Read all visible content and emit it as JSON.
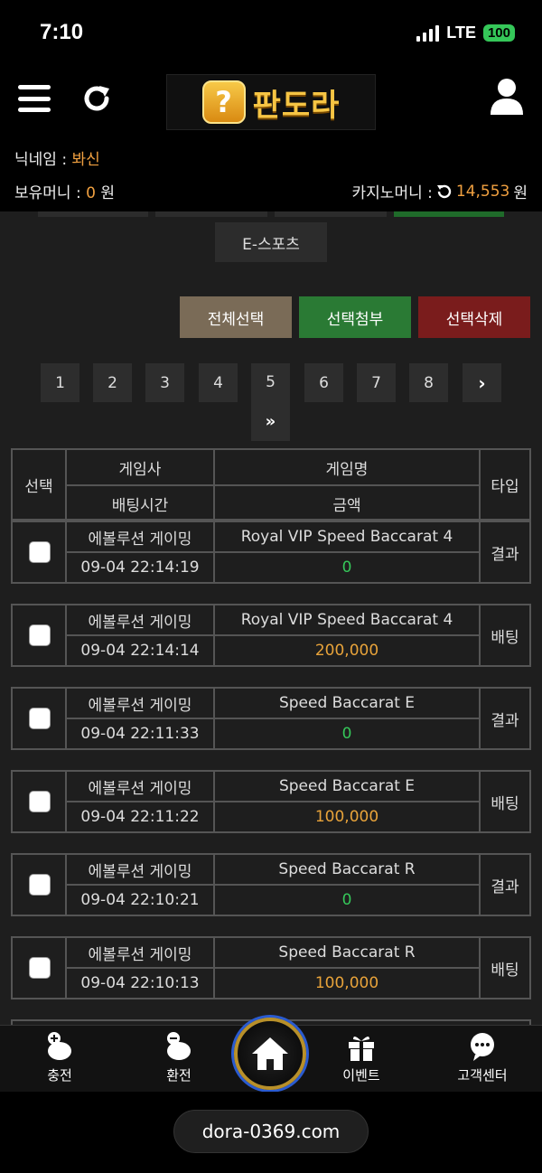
{
  "status_bar": {
    "time": "7:10",
    "network": "LTE",
    "battery": "100"
  },
  "header": {
    "logo_text": "판도라",
    "logo_symbol": "?"
  },
  "user_info": {
    "nickname_label": "닉네임 : ",
    "nickname_value": "봐신",
    "holding_label": "보유머니 : ",
    "holding_value": "0",
    "holding_unit": " 원",
    "casino_label": "카지노머니 : ",
    "casino_value": "14,553",
    "casino_unit": " 원"
  },
  "category_tab": "E-스포츠",
  "actions": {
    "select_all": "전체선택",
    "attach_selected": "선택첨부",
    "delete_selected": "선택삭제"
  },
  "pagination": {
    "pages": [
      "1",
      "2",
      "3",
      "4",
      "5",
      "6",
      "7",
      "8"
    ],
    "current": "5",
    "next": "›",
    "last": "»"
  },
  "table_headers": {
    "select": "선택",
    "provider": "게임사",
    "game": "게임명",
    "type": "타입",
    "bet_time": "배팅시간",
    "amount": "금액"
  },
  "rows": [
    {
      "provider": "에볼루션 게이밍",
      "game": "Royal VIP Speed Baccarat 4",
      "type": "결과",
      "time": "09-04 22:14:19",
      "amount": "0"
    },
    {
      "provider": "에볼루션 게이밍",
      "game": "Royal VIP Speed Baccarat 4",
      "type": "배팅",
      "time": "09-04 22:14:14",
      "amount": "200,000"
    },
    {
      "provider": "에볼루션 게이밍",
      "game": "Speed Baccarat E",
      "type": "결과",
      "time": "09-04 22:11:33",
      "amount": "0"
    },
    {
      "provider": "에볼루션 게이밍",
      "game": "Speed Baccarat E",
      "type": "배팅",
      "time": "09-04 22:11:22",
      "amount": "100,000"
    },
    {
      "provider": "에볼루션 게이밍",
      "game": "Speed Baccarat R",
      "type": "결과",
      "time": "09-04 22:10:21",
      "amount": "0"
    },
    {
      "provider": "에볼루션 게이밍",
      "game": "Speed Baccarat R",
      "type": "배팅",
      "time": "09-04 22:10:13",
      "amount": "100,000"
    }
  ],
  "bottom_nav": {
    "charge": "충전",
    "exchange": "환전",
    "events": "이벤트",
    "support": "고객센터"
  },
  "url": "dora-0369.com",
  "colors": {
    "accent_orange": "#f0a040",
    "result_green": "#35c759",
    "bet_orange": "#e8a33a",
    "logo_gold": "#f6c544"
  }
}
